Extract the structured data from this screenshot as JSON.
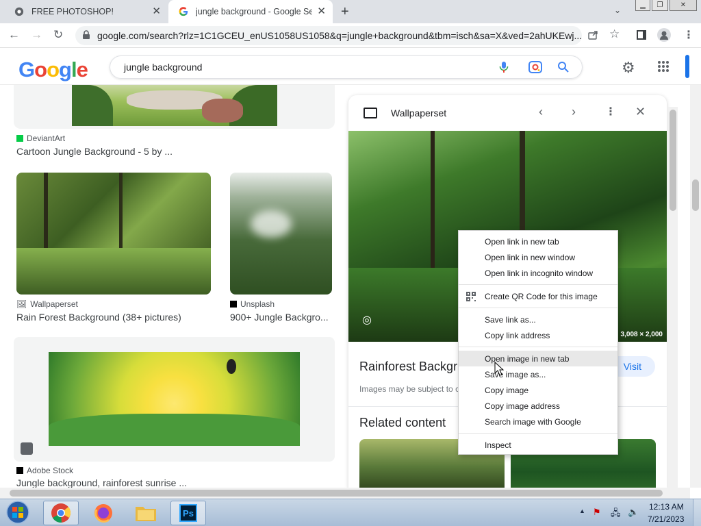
{
  "tabs": [
    {
      "title": "FREE PHOTOSHOP!",
      "icon": "chrome-icon"
    },
    {
      "title": "jungle background - Google Sear",
      "icon": "google-icon",
      "active": true
    }
  ],
  "toolbar": {
    "url": "google.com/search?rlz=1C1GCEU_enUS1058US1058&q=jungle+background&tbm=isch&sa=X&ved=2ahUKEwj..."
  },
  "search": {
    "query": "jungle background",
    "logo": "Google"
  },
  "results": [
    {
      "source": "DeviantArt",
      "title": "Cartoon Jungle Background - 5 by ..."
    },
    {
      "source": "Wallpaperset",
      "title": "Rain Forest Background (38+ pictures)"
    },
    {
      "source": "Unsplash",
      "title": "900+ Jungle Backgro..."
    },
    {
      "source": "Adobe Stock",
      "title": "Jungle background, rainforest sunrise ..."
    }
  ],
  "panel": {
    "source": "Wallpaperset",
    "dimensions": "3,008 × 2,000",
    "title": "Rainforest Backgr",
    "visit": "Visit",
    "copyright": "Images may be subject to c",
    "related": "Related content"
  },
  "context_menu": {
    "items": [
      "Open link in new tab",
      "Open link in new window",
      "Open link in incognito window",
      "Create QR Code for this image",
      "Save link as...",
      "Copy link address",
      "Open image in new tab",
      "Save image as...",
      "Copy image",
      "Copy image address",
      "Search image with Google",
      "Inspect"
    ],
    "highlighted_index": 6
  },
  "taskbar": {
    "time": "12:13 AM",
    "date": "7/21/2023"
  },
  "colors": {
    "accent": "#1a73e8",
    "google_blue": "#4285f4",
    "google_red": "#ea4335",
    "google_yellow": "#fbbc05",
    "google_green": "#34a853"
  }
}
